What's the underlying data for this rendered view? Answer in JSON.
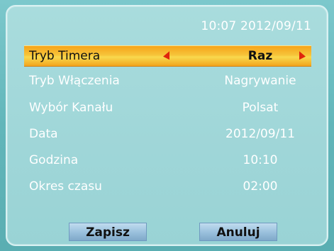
{
  "clock": "10:07 2012/09/11",
  "rows": [
    {
      "label": "Tryb Timera",
      "value": "Raz"
    },
    {
      "label": "Tryb Włączenia",
      "value": "Nagrywanie"
    },
    {
      "label": "Wybór Kanału",
      "value": "Polsat"
    },
    {
      "label": "Data",
      "value": "2012/09/11"
    },
    {
      "label": "Godzina",
      "value": "10:10"
    },
    {
      "label": "Okres czasu",
      "value": "02:00"
    }
  ],
  "buttons": {
    "save": "Zapisz",
    "cancel": "Anuluj"
  },
  "colors": {
    "background": "#a9dcdd",
    "text": "#ffffff",
    "highlight": "#f6c43a",
    "arrow": "#e0250c",
    "button": "#9cc2de"
  },
  "icons": {
    "left": "arrow-left-icon",
    "right": "arrow-right-icon"
  }
}
